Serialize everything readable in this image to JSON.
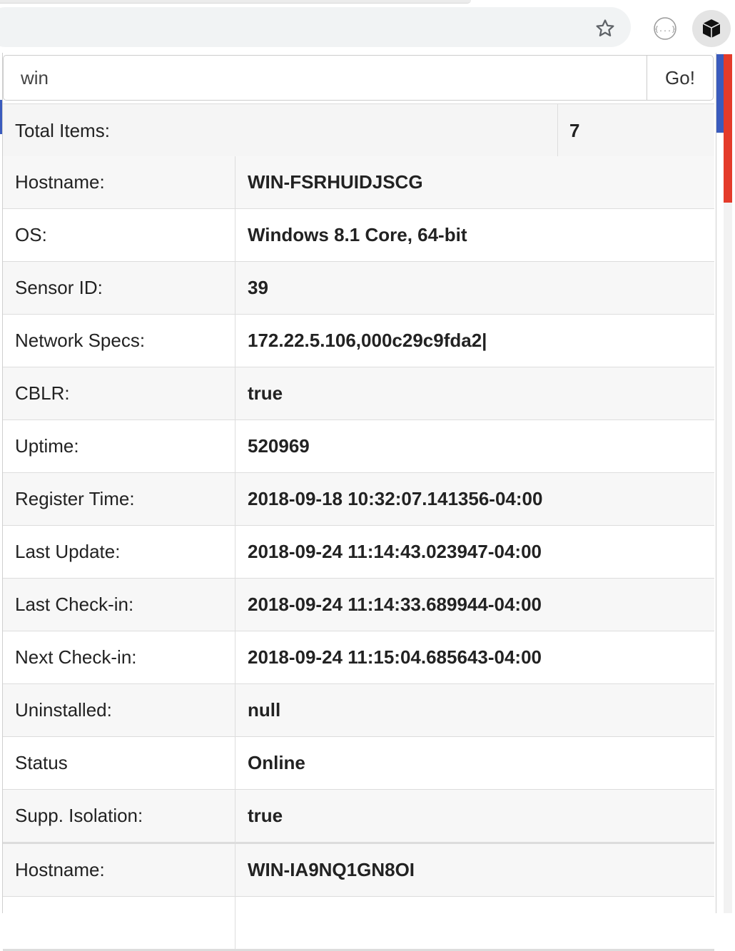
{
  "search": {
    "value": "win",
    "go_label": "Go!"
  },
  "total": {
    "label": "Total Items:",
    "value": "7"
  },
  "records": [
    {
      "rows": [
        {
          "label": "Hostname:",
          "value": "WIN-FSRHUIDJSCG"
        },
        {
          "label": "OS:",
          "value": "Windows 8.1 Core, 64-bit"
        },
        {
          "label": "Sensor ID:",
          "value": "39"
        },
        {
          "label": "Network Specs:",
          "value": "172.22.5.106,000c29c9fda2|"
        },
        {
          "label": "CBLR:",
          "value": "true"
        },
        {
          "label": "Uptime:",
          "value": "520969"
        },
        {
          "label": "Register Time:",
          "value": "2018-09-18 10:32:07.141356-04:00"
        },
        {
          "label": "Last Update:",
          "value": "2018-09-24 11:14:43.023947-04:00"
        },
        {
          "label": "Last Check-in:",
          "value": "2018-09-24 11:14:33.689944-04:00"
        },
        {
          "label": "Next Check-in:",
          "value": "2018-09-24 11:15:04.685643-04:00"
        },
        {
          "label": "Uninstalled:",
          "value": "null"
        },
        {
          "label": "Status",
          "value": "Online"
        },
        {
          "label": "Supp. Isolation:",
          "value": "true"
        }
      ]
    },
    {
      "rows": [
        {
          "label": "Hostname:",
          "value": "WIN-IA9NQ1GN8OI"
        },
        {
          "label": "",
          "value": ""
        }
      ]
    }
  ],
  "icons": {
    "bookmark": "star-icon",
    "extension_json": "json-extension-icon",
    "extension_cube": "cube-extension-icon"
  }
}
